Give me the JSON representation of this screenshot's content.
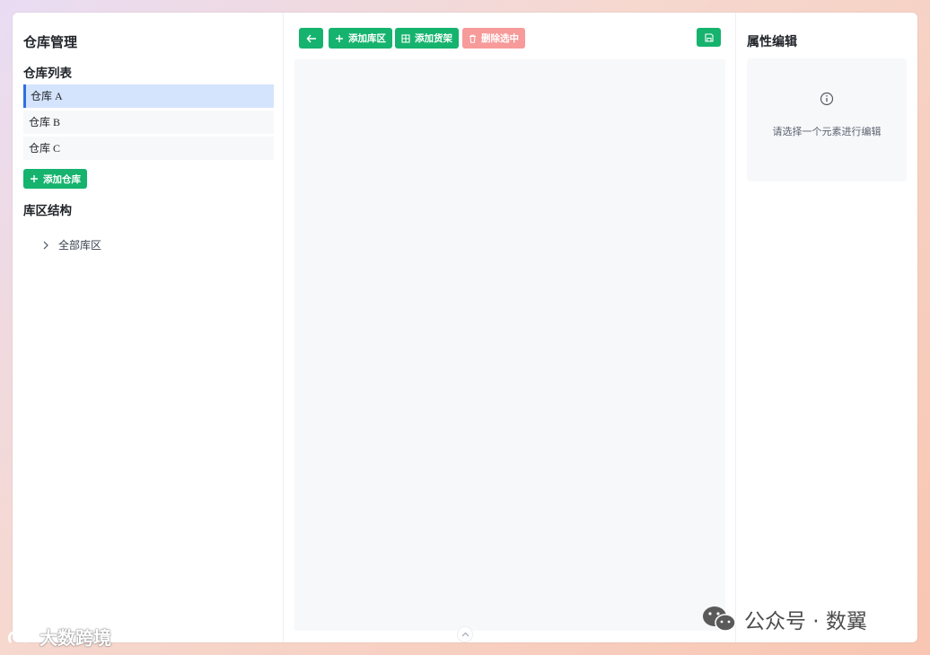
{
  "sidebar": {
    "title": "仓库管理",
    "warehouse_list_title": "仓库列表",
    "warehouses": [
      {
        "label": "仓库 A",
        "active": true
      },
      {
        "label": "仓库 B",
        "active": false
      },
      {
        "label": "仓库 C",
        "active": false
      }
    ],
    "add_warehouse": "添加仓库",
    "zone_structure_title": "库区结构",
    "tree_root": "全部库区"
  },
  "toolbar": {
    "back_icon": "arrow-left-icon",
    "add_zone": "添加库区",
    "add_shelf": "添加货架",
    "delete_selected": "删除选中",
    "save_icon": "save-icon"
  },
  "properties": {
    "title": "属性编辑",
    "empty_message": "请选择一个元素进行编辑"
  },
  "watermarks": {
    "left": "大数跨境",
    "right": "公众号 · 数翼"
  },
  "colors": {
    "primary_green": "#16b36e",
    "danger_pink": "#f79a9a",
    "active_blue": "#d5e4fd",
    "active_border": "#2f6fe0"
  }
}
